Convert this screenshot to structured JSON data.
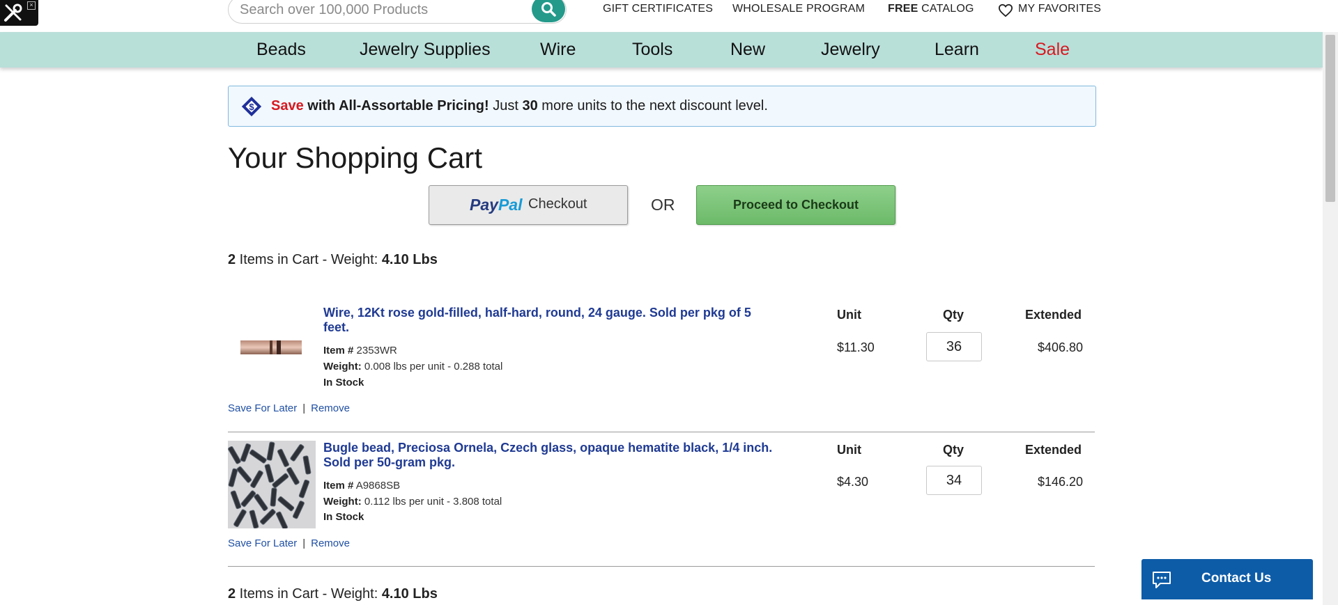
{
  "toolbadge": {
    "icon": "tools-icon"
  },
  "search": {
    "placeholder": "Search over 100,000 Products"
  },
  "utility": {
    "gift": "GIFT CERTIFICATES",
    "wholesale": "WHOLESALE PROGRAM",
    "catalog_bold": "FREE",
    "catalog_rest": " CATALOG",
    "favorites": "MY FAVORITES"
  },
  "nav": [
    "Beads",
    "Jewelry Supplies",
    "Wire",
    "Tools",
    "New",
    "Jewelry",
    "Learn",
    "Sale"
  ],
  "promo": {
    "save": "Save",
    "bold": " with All-Assortable Pricing!",
    "pre": " Just ",
    "count": "30",
    "post": " more units to the next discount level."
  },
  "page_title": "Your Shopping Cart",
  "checkout": {
    "paypal_brand_1": "Pay",
    "paypal_brand_2": "Pal",
    "paypal_label": "Checkout",
    "or": "OR",
    "proceed": "Proceed to Checkout"
  },
  "summary": {
    "count": "2",
    "items_text": " Items in Cart - Weight: ",
    "weight": "4.10 Lbs"
  },
  "columns": {
    "unit": "Unit",
    "qty": "Qty",
    "extended": "Extended"
  },
  "item_labels": {
    "item_no": "Item #",
    "weight": "Weight:",
    "save_later": "Save For Later",
    "sep": "|",
    "remove": "Remove"
  },
  "items": [
    {
      "name": "Wire, 12Kt rose gold-filled, half-hard, round, 24 gauge. Sold per pkg of 5 feet.",
      "item_no": "2353WR",
      "weight": "0.008 lbs per unit - 0.288 total",
      "stock": "In Stock",
      "unit": "$11.30",
      "qty": "36",
      "extended": "$406.80"
    },
    {
      "name": "Bugle bead, Preciosa Ornela, Czech glass, opaque hematite black, 1/4 inch. Sold per 50-gram pkg.",
      "item_no": "A9868SB",
      "weight": "0.112 lbs per unit - 3.808 total",
      "stock": "In Stock",
      "unit": "$4.30",
      "qty": "34",
      "extended": "$146.20"
    }
  ],
  "contact": {
    "label": "Contact Us"
  },
  "colors": {
    "teal": "#249a8b",
    "nav_bg": "#b9dfd9",
    "sale_red": "#d71920",
    "link_blue": "#1f3a93",
    "contact_blue": "#0d5ca8"
  }
}
